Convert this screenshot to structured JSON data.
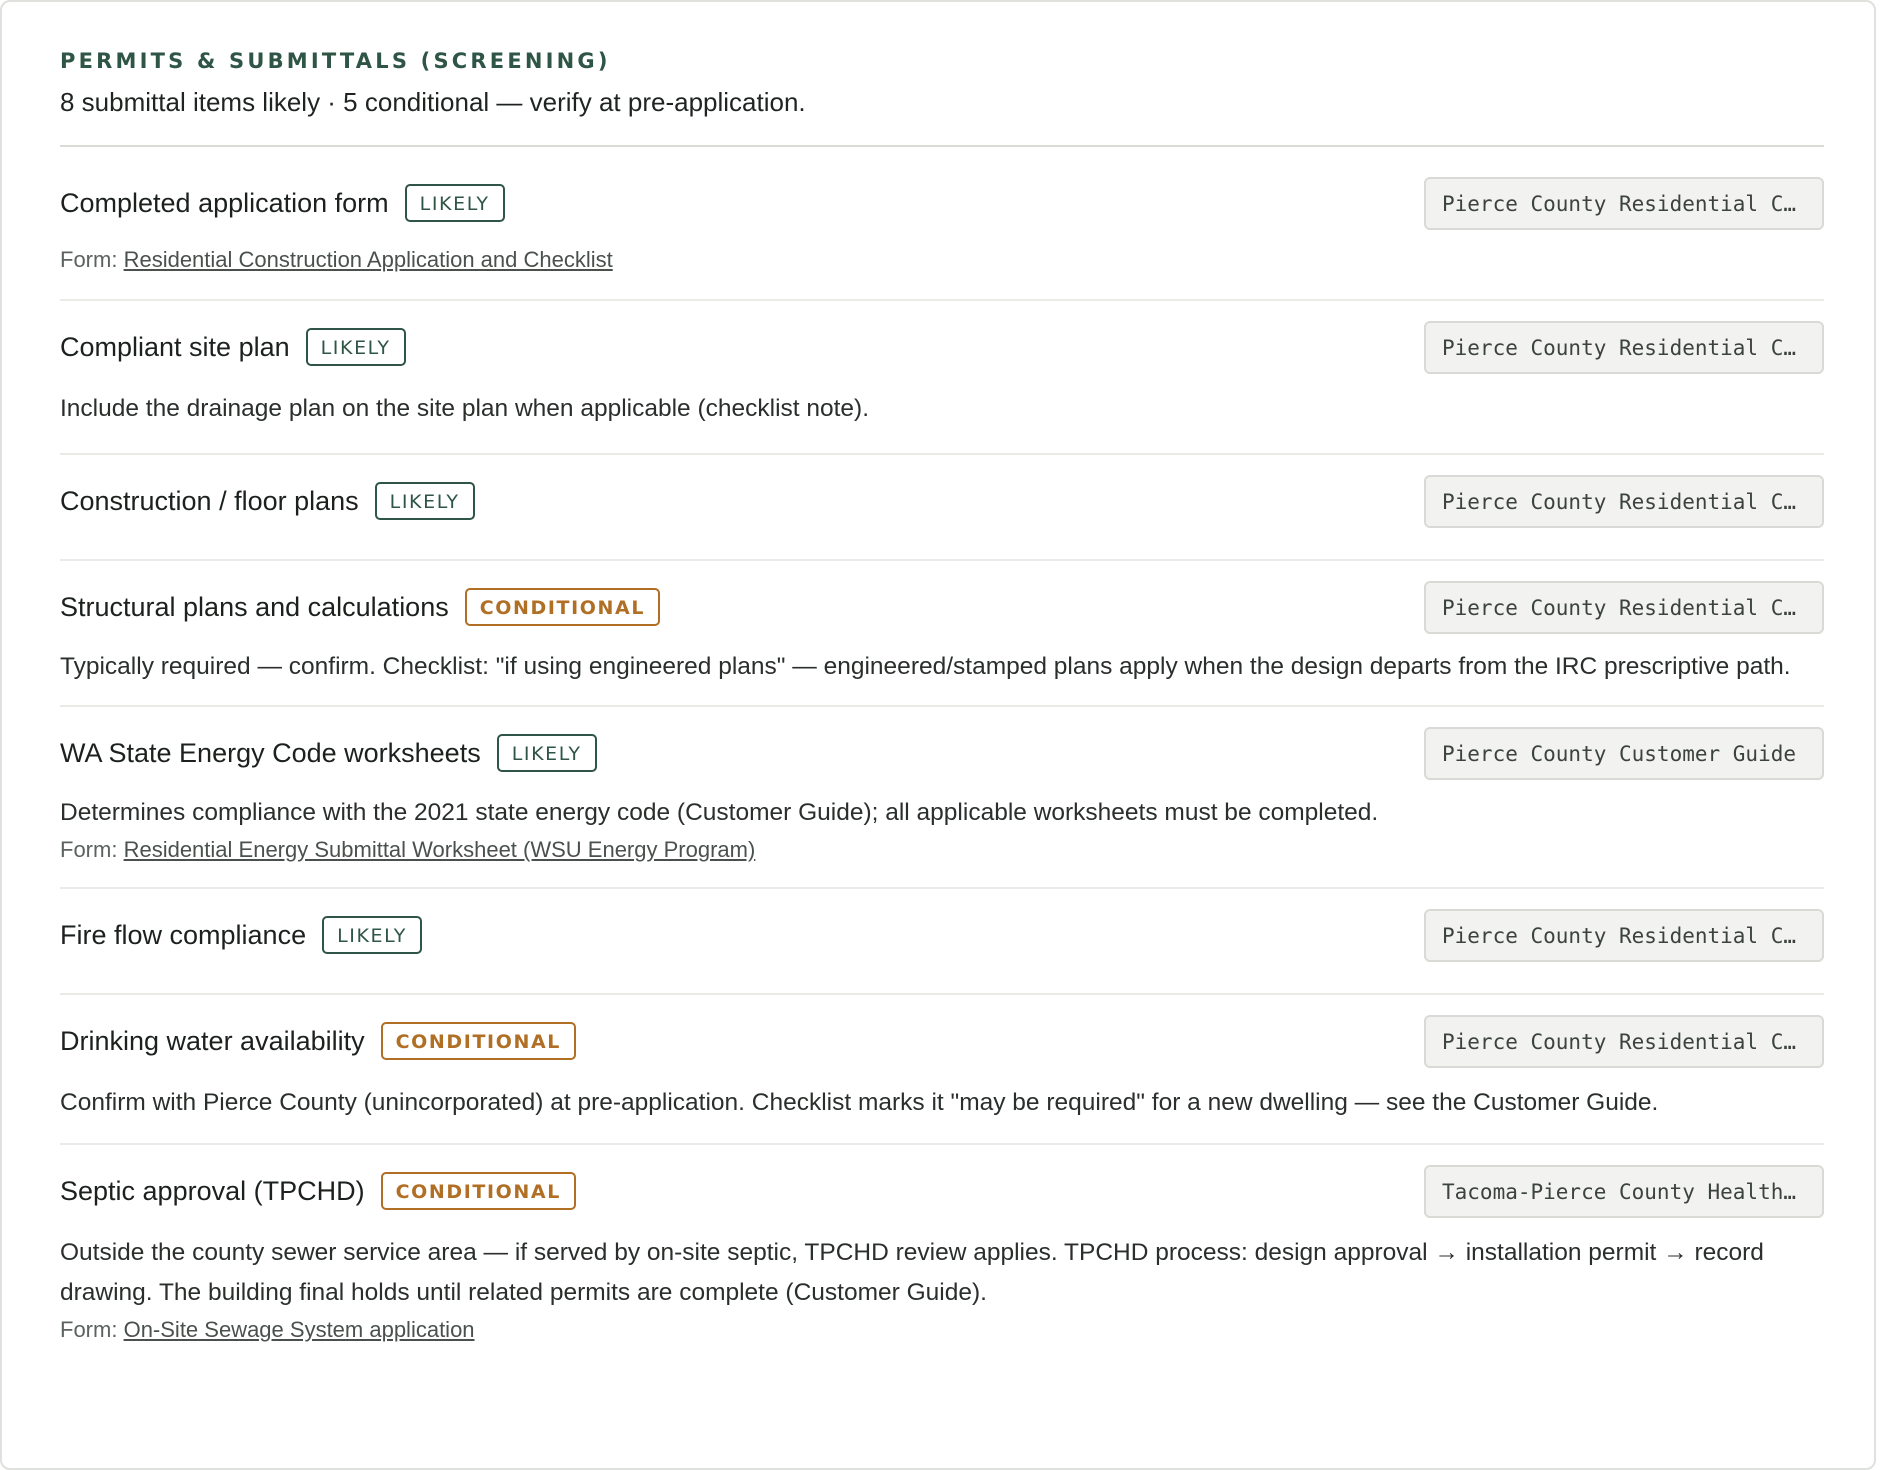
{
  "header": {
    "eyebrow": "PERMITS & SUBMITTALS (SCREENING)",
    "summary": "8 submittal items likely · 5 conditional — verify at pre-application."
  },
  "form_prefix": "Form:",
  "colors": {
    "likely": "#2f5546",
    "conditional": "#b06f24"
  },
  "items": [
    {
      "title": "Completed application form",
      "status": "LIKELY",
      "source": "Pierce County Residential Construction Application and Checklist",
      "note": "",
      "form": "Residential Construction Application and Checklist"
    },
    {
      "title": "Compliant site plan",
      "status": "LIKELY",
      "source": "Pierce County Residential Construction Application and Checklist",
      "note": "Include the drainage plan on the site plan when applicable (checklist note).",
      "form": ""
    },
    {
      "title": "Construction / floor plans",
      "status": "LIKELY",
      "source": "Pierce County Residential Construction Application and Checklist",
      "note": "",
      "form": ""
    },
    {
      "title": "Structural plans and calculations",
      "status": "CONDITIONAL",
      "source": "Pierce County Residential Construction Application and Checklist",
      "note": "Typically required — confirm. Checklist: \"if using engineered plans\" — engineered/stamped plans apply when the design departs from the IRC prescriptive path.",
      "form": ""
    },
    {
      "title": "WA State Energy Code worksheets",
      "status": "LIKELY",
      "source": "Pierce County Customer Guide",
      "note": "Determines compliance with the 2021 state energy code (Customer Guide); all applicable worksheets must be completed.",
      "form": "Residential Energy Submittal Worksheet (WSU Energy Program)"
    },
    {
      "title": "Fire flow compliance",
      "status": "LIKELY",
      "source": "Pierce County Residential Construction Application and Checklist",
      "note": "",
      "form": ""
    },
    {
      "title": "Drinking water availability",
      "status": "CONDITIONAL",
      "source": "Pierce County Residential Construction Application and Checklist",
      "note": "Confirm with Pierce County (unincorporated) at pre-application. Checklist marks it \"may be required\" for a new dwelling — see the Customer Guide.",
      "form": ""
    },
    {
      "title": "Septic approval (TPCHD)",
      "status": "CONDITIONAL",
      "source": "Tacoma-Pierce County Health Department",
      "note": "Outside the county sewer service area — if served by on-site septic, TPCHD review applies. TPCHD process: design approval → installation permit → record drawing. The building final holds until related permits are complete (Customer Guide).",
      "form": "On-Site Sewage System application"
    }
  ]
}
